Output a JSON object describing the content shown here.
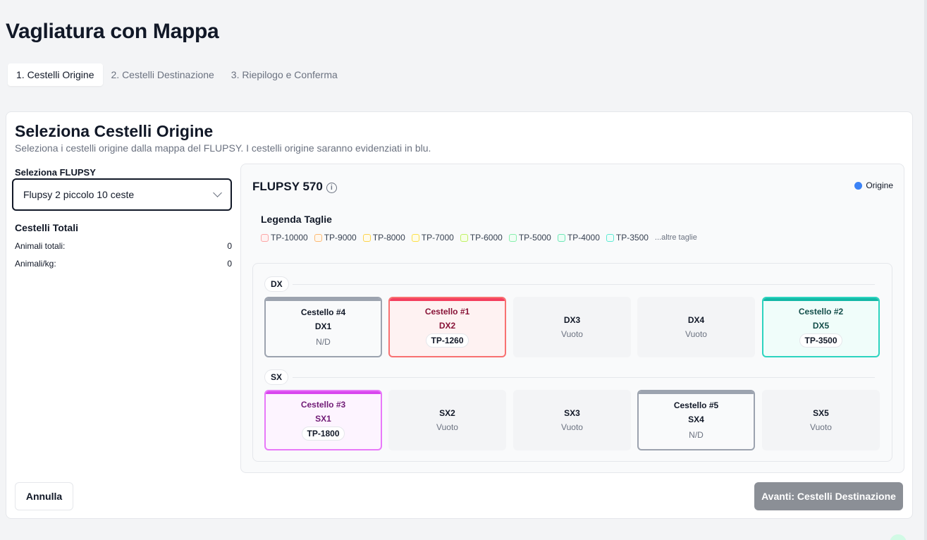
{
  "page": {
    "title": "Vagliatura con Mappa"
  },
  "tabs": [
    {
      "label": "1. Cestelli Origine",
      "active": true
    },
    {
      "label": "2. Cestelli Destinazione",
      "active": false
    },
    {
      "label": "3. Riepilogo e Conferma",
      "active": false
    }
  ],
  "card": {
    "title": "Seleziona Cestelli Origine",
    "description": "Seleziona i cestelli origine dalla mappa del FLUPSY. I cestelli origine saranno evidenziati in blu."
  },
  "left": {
    "select_label": "Seleziona FLUPSY",
    "select_value": "Flupsy 2 piccolo 10 ceste",
    "totals_title": "Cestelli Totali",
    "stats": [
      {
        "label": "Animali totali:",
        "value": "0"
      },
      {
        "label": "Animali/kg:",
        "value": "0"
      }
    ]
  },
  "map": {
    "flupsy_name": "FLUPSY 570",
    "info_icon": "info-icon",
    "origin_legend": "Origine",
    "origin_color": "#3b82f6",
    "legend_title": "Legenda Taglie",
    "legend_items": [
      {
        "label": "TP-10000",
        "color": "#fca5a5",
        "fill": "#fef2f2"
      },
      {
        "label": "TP-9000",
        "color": "#fdba74",
        "fill": "#fff7ed"
      },
      {
        "label": "TP-8000",
        "color": "#fcd34d",
        "fill": "#fffbeb"
      },
      {
        "label": "TP-7000",
        "color": "#fde047",
        "fill": "#fefce8"
      },
      {
        "label": "TP-6000",
        "color": "#bef264",
        "fill": "#f7fee7"
      },
      {
        "label": "TP-5000",
        "color": "#86efac",
        "fill": "#f0fdf4"
      },
      {
        "label": "TP-4000",
        "color": "#6ee7b7",
        "fill": "#ecfdf5"
      },
      {
        "label": "TP-3500",
        "color": "#5eead4",
        "fill": "#f0fdfa"
      }
    ],
    "legend_more": "...altre taglie",
    "rows": [
      {
        "label": "DX",
        "baskets": [
          {
            "name": "Cestello #4",
            "position": "DX1",
            "sub": "N/D",
            "tag": "",
            "border": "#9ca3af",
            "bar": "#9ca3af",
            "bg": "#f9fafb",
            "text": "#111827"
          },
          {
            "name": "Cestello #1",
            "position": "DX2",
            "sub": "",
            "tag": "TP-1260",
            "border": "#f87171",
            "bar": "#f43f5e",
            "bg": "#fef2f2",
            "text": "#881337"
          },
          {
            "name": "",
            "position": "DX3",
            "sub": "Vuoto",
            "tag": ""
          },
          {
            "name": "",
            "position": "DX4",
            "sub": "Vuoto",
            "tag": ""
          },
          {
            "name": "Cestello #2",
            "position": "DX5",
            "sub": "",
            "tag": "TP-3500",
            "border": "#2dd4bf",
            "bar": "#14b8a6",
            "bg": "#f0fdfa",
            "text": "#134e4a"
          }
        ]
      },
      {
        "label": "SX",
        "baskets": [
          {
            "name": "Cestello #3",
            "position": "SX1",
            "sub": "",
            "tag": "TP-1800",
            "border": "#e879f9",
            "bar": "#d946ef",
            "bg": "#fdf4ff",
            "text": "#701a75"
          },
          {
            "name": "",
            "position": "SX2",
            "sub": "Vuoto",
            "tag": ""
          },
          {
            "name": "",
            "position": "SX3",
            "sub": "Vuoto",
            "tag": ""
          },
          {
            "name": "Cestello #5",
            "position": "SX4",
            "sub": "N/D",
            "tag": "",
            "border": "#9ca3af",
            "bar": "#9ca3af",
            "bg": "#f9fafb",
            "text": "#111827"
          },
          {
            "name": "",
            "position": "SX5",
            "sub": "Vuoto",
            "tag": ""
          }
        ]
      }
    ]
  },
  "actions": {
    "cancel_label": "Annulla",
    "next_label": "Avanti: Cestelli Destinazione"
  }
}
